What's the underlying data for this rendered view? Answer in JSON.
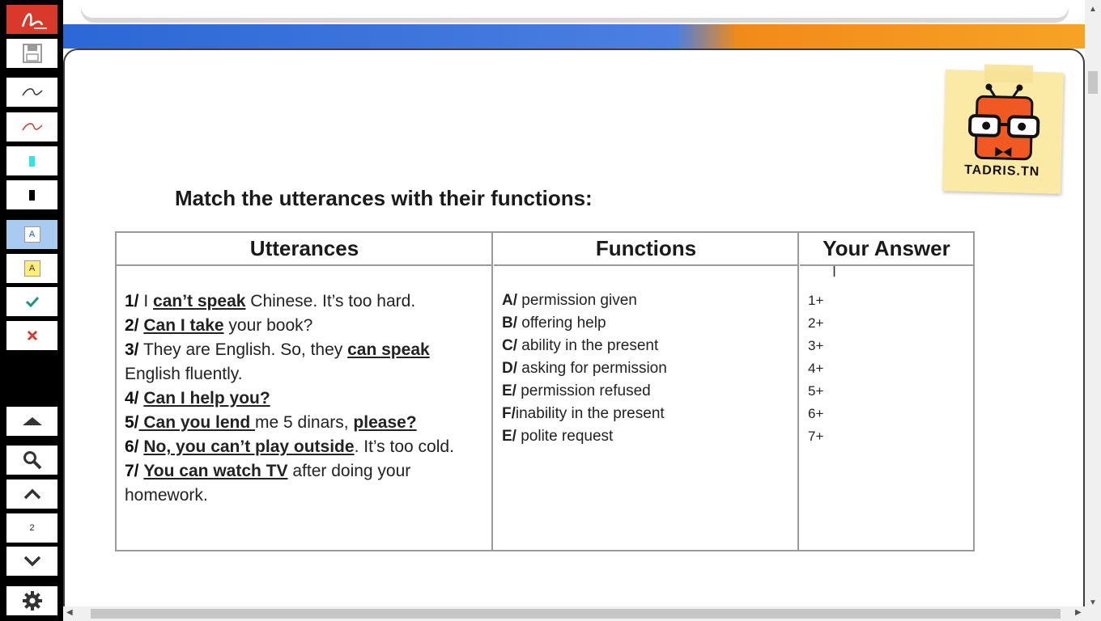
{
  "toolbar": {
    "page_number": "2",
    "colors": {
      "pen_dark": "#333333",
      "pen_red": "#d9392b",
      "highlight_cyan": "#2ee6e6",
      "highlight_black": "#000000",
      "text_blue": "#2b4fb6",
      "text_yellow": "#ffef7a",
      "check": "#1a9a6c",
      "cross": "#d9392b"
    }
  },
  "logo": {
    "text": "TADRIS.TN"
  },
  "worksheet": {
    "title": "Match the utterances with their functions:",
    "headers": {
      "utterances": "Utterances",
      "functions": "Functions",
      "answer": "Your Answer"
    },
    "utterances": [
      {
        "num": "1/",
        "pre": " I ",
        "bold": "can’t speak",
        "post": " Chinese. It’s too hard."
      },
      {
        "num": "2/",
        "pre": " ",
        "bold": "Can I take",
        "post": " your book?"
      },
      {
        "num": "3/",
        "pre": " They are English. So, they ",
        "bold": "can speak",
        "post": ""
      },
      {
        "num": "",
        "pre": "English fluently.",
        "bold": "",
        "post": ""
      },
      {
        "num": "4/",
        "pre": " ",
        "bold": "Can I help you?",
        "post": ""
      },
      {
        "num": "5/",
        "pre": "",
        "bold": " Can you lend ",
        "post": "me 5 dinars, ",
        "bold2": "please?"
      },
      {
        "num": "6/",
        "pre": " ",
        "bold": "No, you can’t play outside",
        "post": ". It’s too cold."
      },
      {
        "num": "7/",
        "pre": " ",
        "bold": "You can watch TV",
        "post": " after doing your"
      },
      {
        "num": "",
        "pre": "homework.",
        "bold": "",
        "post": ""
      }
    ],
    "functions": [
      {
        "letter": "A/",
        "text": " permission given"
      },
      {
        "letter": "B/",
        "text": " offering help"
      },
      {
        "letter": "C/",
        "text": " ability in the present"
      },
      {
        "letter": "D/",
        "text": " asking for permission"
      },
      {
        "letter": "E/",
        "text": " permission refused"
      },
      {
        "letter": "F/",
        "text": "inability in the present"
      },
      {
        "letter": "E/",
        "text": " polite request"
      }
    ],
    "answers": [
      "1+",
      "2+",
      "3+",
      "4+",
      "5+",
      "6+",
      "7+"
    ]
  }
}
